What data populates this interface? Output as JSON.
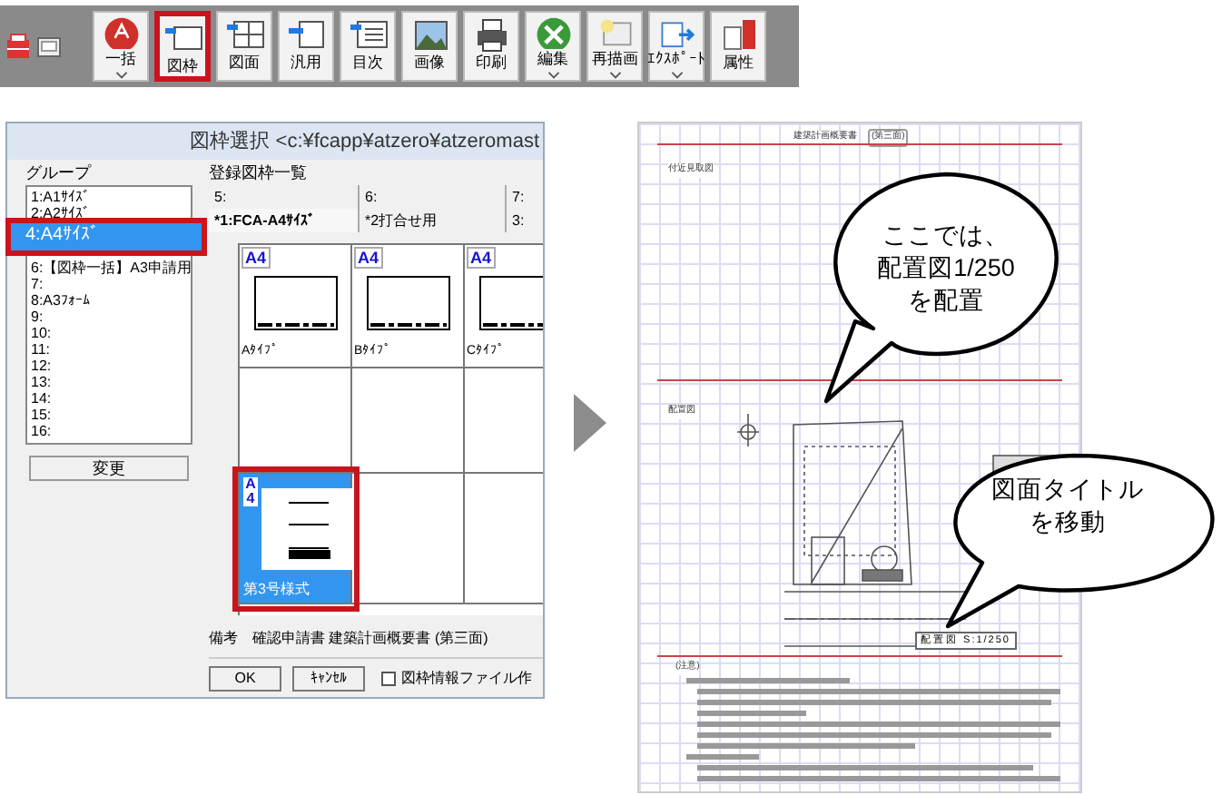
{
  "toolbar": {
    "buttons": [
      {
        "label": "一括",
        "dropdown": true,
        "highlighted": false
      },
      {
        "label": "図枠",
        "dropdown": false,
        "highlighted": true
      },
      {
        "label": "図面",
        "dropdown": false,
        "highlighted": false
      },
      {
        "label": "汎用",
        "dropdown": false,
        "highlighted": false
      },
      {
        "label": "目次",
        "dropdown": false,
        "highlighted": false
      },
      {
        "label": "画像",
        "dropdown": false,
        "highlighted": false
      },
      {
        "label": "印刷",
        "dropdown": false,
        "highlighted": false
      },
      {
        "label": "編集",
        "dropdown": true,
        "highlighted": false
      },
      {
        "label": "再描画",
        "dropdown": true,
        "highlighted": false
      },
      {
        "label": "ｴｸｽﾎﾟｰﾄ",
        "dropdown": true,
        "highlighted": false
      },
      {
        "label": "属性",
        "dropdown": false,
        "highlighted": false
      }
    ]
  },
  "dialog": {
    "title": "図枠選択 <c:¥fcapp¥atzero¥atzeromast",
    "group_label": "グループ",
    "groups": [
      {
        "label": "1:A1ｻｲｽﾞ",
        "selected": false
      },
      {
        "label": "2:A2ｻｲｽﾞ",
        "selected": false
      },
      {
        "label": "4:A4ｻｲｽﾞ",
        "selected": true
      },
      {
        "label": "6:【図枠一括】A3申請用",
        "selected": false
      },
      {
        "label": "7:",
        "selected": false
      },
      {
        "label": "8:A3ﾌｫｰﾑ",
        "selected": false
      },
      {
        "label": "9:",
        "selected": false
      },
      {
        "label": "10:",
        "selected": false
      },
      {
        "label": "11:",
        "selected": false
      },
      {
        "label": "12:",
        "selected": false
      },
      {
        "label": "13:",
        "selected": false
      },
      {
        "label": "14:",
        "selected": false
      },
      {
        "label": "15:",
        "selected": false
      },
      {
        "label": "16:",
        "selected": false
      }
    ],
    "change_button": "変更",
    "list_label": "登録図枠一覧",
    "tab_rows": [
      [
        {
          "label": "5:",
          "selected": false
        },
        {
          "label": "6:",
          "selected": false
        },
        {
          "label": "7:",
          "selected": false
        }
      ],
      [
        {
          "label": "*1:FCA-A4ｻｲｽﾞ",
          "selected": true
        },
        {
          "label": "*2打合せ用",
          "selected": false
        },
        {
          "label": "3:",
          "selected": false
        }
      ]
    ],
    "cells": [
      {
        "kind": "frame",
        "badge": "A4",
        "caption": "Aﾀｲﾌﾟ",
        "selected": false
      },
      {
        "kind": "frame",
        "badge": "A4",
        "caption": "Bﾀｲﾌﾟ",
        "selected": false
      },
      {
        "kind": "frame",
        "badge": "A4",
        "caption": "Cﾀｲﾌﾟ",
        "selected": false
      },
      {
        "kind": "empty",
        "selected": false
      },
      {
        "kind": "empty",
        "selected": false
      },
      {
        "kind": "empty",
        "selected": false
      },
      {
        "kind": "form",
        "badge": "A4",
        "caption": "第3号様式",
        "selected": true
      },
      {
        "kind": "empty",
        "selected": false
      },
      {
        "kind": "empty",
        "selected": false
      }
    ],
    "remark": "備考　確認申請書 建築計画概要書 (第三面)",
    "ok_button": "OK",
    "cancel_button": "ｷｬﾝｾﾙ",
    "checkbox": {
      "label": "図枠情報ファイル作",
      "checked": false
    }
  },
  "document": {
    "title": "建築計画概要書",
    "title_badge": "(第三面)",
    "section_1": "付近見取図",
    "section_2": "配置図",
    "drawing_title": "配置図 S:1/250",
    "notes_heading": "(注意)"
  },
  "callouts": [
    {
      "lines": [
        "ここでは、",
        "配置図1/250",
        "を配置"
      ]
    },
    {
      "lines": [
        "図面タイトル",
        "を移動"
      ]
    }
  ]
}
